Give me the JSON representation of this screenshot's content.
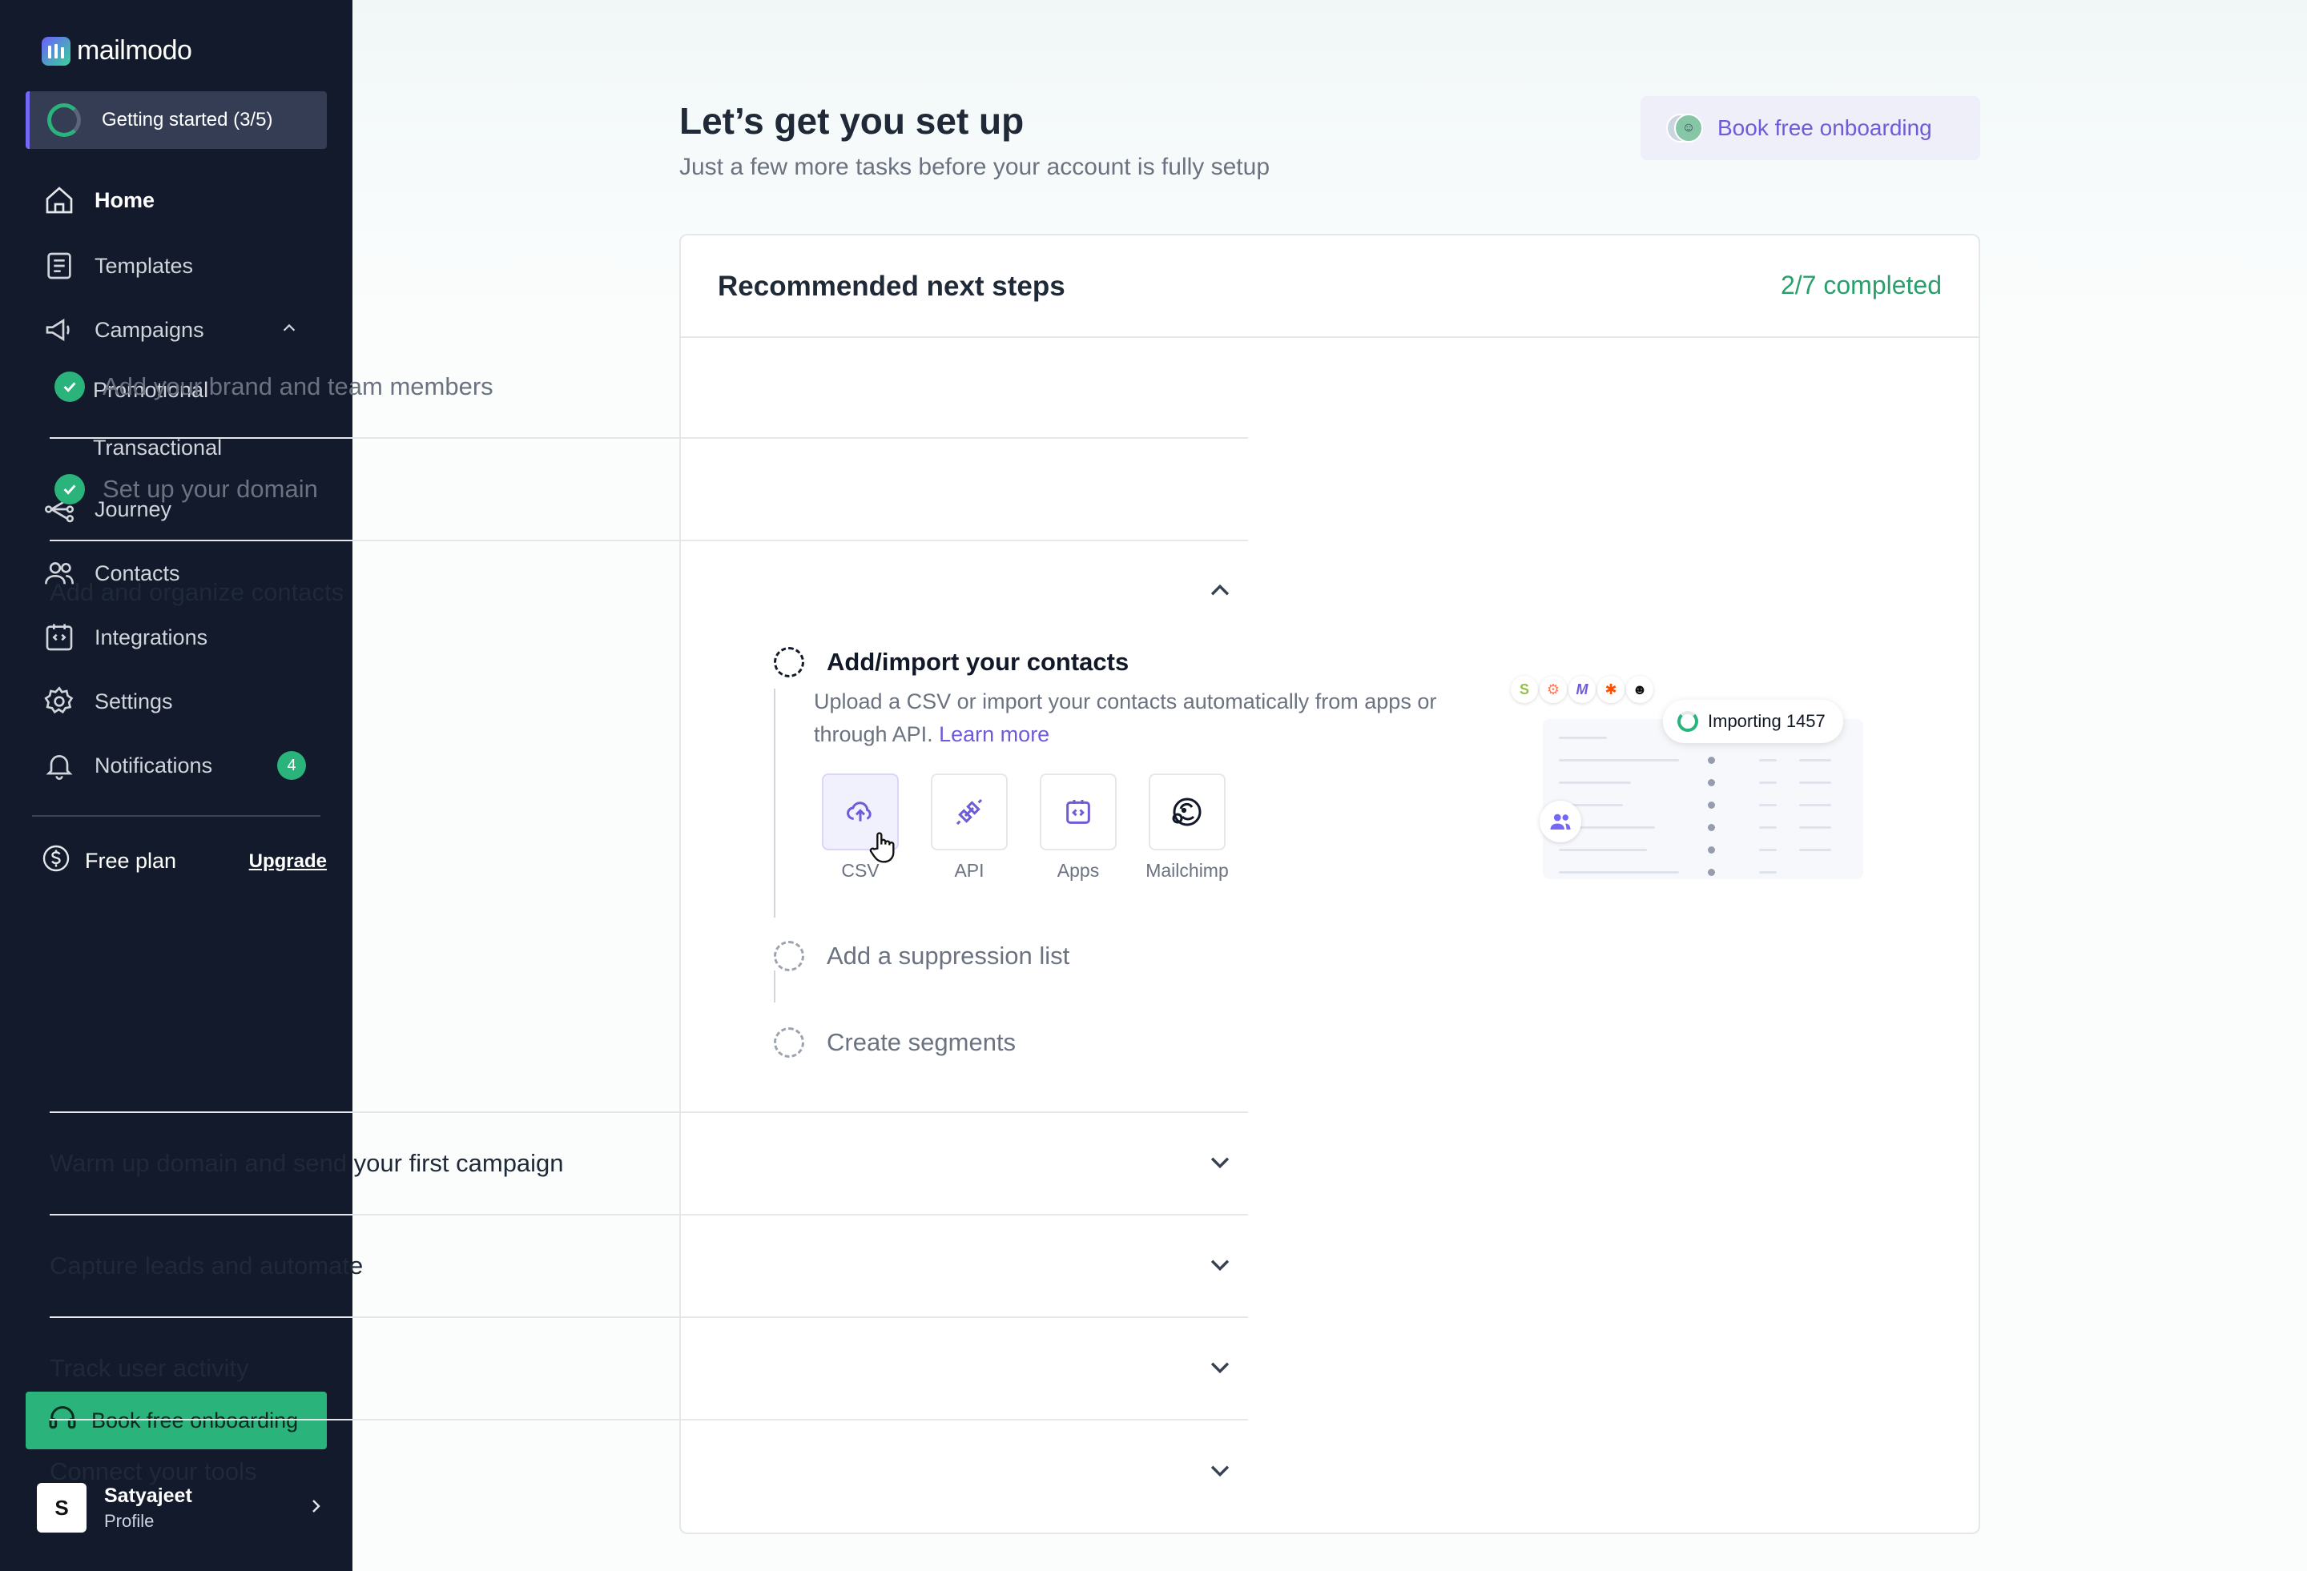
{
  "app": {
    "name": "mailmodo"
  },
  "sidebar": {
    "getting_started": "Getting started (3/5)",
    "items": [
      {
        "label": "Home",
        "icon": "home-icon"
      },
      {
        "label": "Templates",
        "icon": "templates-icon"
      },
      {
        "label": "Campaigns",
        "icon": "megaphone-icon"
      },
      {
        "label": "Journey",
        "icon": "journey-icon"
      },
      {
        "label": "Contacts",
        "icon": "contacts-icon"
      },
      {
        "label": "Integrations",
        "icon": "integrations-icon"
      },
      {
        "label": "Settings",
        "icon": "gear-icon"
      },
      {
        "label": "Notifications",
        "icon": "bell-icon",
        "badge": "4"
      }
    ],
    "campaign_subitems": [
      "Promotional",
      "Transactional"
    ],
    "plan": {
      "label": "Free plan",
      "upgrade": "Upgrade"
    },
    "book_onboarding": "Book free onboarding",
    "profile": {
      "initial": "S",
      "name": "Satyajeet",
      "sub": "Profile"
    }
  },
  "header": {
    "title": "Let’s get you set up",
    "subtitle": "Just a few more tasks before your account is fully setup",
    "onboarding_button": "Book free onboarding"
  },
  "card": {
    "title": "Recommended next steps",
    "progress": "2/7 completed",
    "completed": [
      "Add your brand and team members",
      "Set up your domain"
    ],
    "expanded_section": {
      "title": "Add and organize contacts",
      "active_step": {
        "title": "Add/import your contacts",
        "description": "Upload a CSV or import your contacts automatically from apps or through API.",
        "learn_more": "Learn more",
        "options": [
          "CSV",
          "API",
          "Apps",
          "Mailchimp"
        ]
      },
      "pending_steps": [
        "Add a suppression list",
        "Create segments"
      ],
      "illustration": {
        "importing": "Importing 1457"
      }
    },
    "collapsed_sections": [
      "Warm up domain and send your first campaign",
      "Capture leads and automate",
      "Track user activity",
      "Connect your tools"
    ]
  },
  "colors": {
    "sidebar": "#121a2b",
    "accent_green": "#2ab37b",
    "accent_purple": "#6d5bd8"
  }
}
